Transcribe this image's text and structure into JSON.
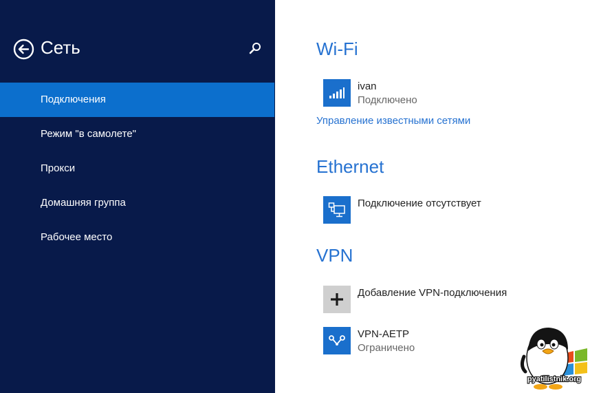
{
  "sidebar": {
    "title": "Сеть",
    "back_icon": "back-arrow-circle-icon",
    "search_icon": "search-icon",
    "bg_color": "#081a4a",
    "selected_color": "#0c6fcd",
    "items": [
      {
        "label": "Подключения",
        "selected": true
      },
      {
        "label": "Режим \"в самолете\"",
        "selected": false
      },
      {
        "label": "Прокси",
        "selected": false
      },
      {
        "label": "Домашняя группа",
        "selected": false
      },
      {
        "label": "Рабочее место",
        "selected": false
      }
    ]
  },
  "main": {
    "accent_color": "#2672d1",
    "wifi": {
      "title": "Wi-Fi",
      "network": {
        "name": "ivan",
        "status": "Подключено",
        "icon": "wifi-signal-icon"
      },
      "manage_link": "Управление известными сетями"
    },
    "ethernet": {
      "title": "Ethernet",
      "item": {
        "name": "Подключение отсутствует",
        "icon": "ethernet-icon"
      }
    },
    "vpn": {
      "title": "VPN",
      "add": {
        "label": "Добавление VPN-подключения",
        "icon": "plus-icon"
      },
      "connection": {
        "name": "VPN-AETP",
        "status": "Ограничено",
        "icon": "vpn-icon"
      }
    }
  },
  "watermark": {
    "text": "pyatilistnik.org",
    "icon": "penguin-logo"
  }
}
